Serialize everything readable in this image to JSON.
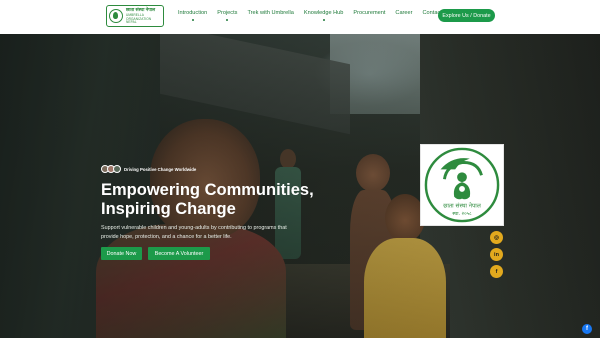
{
  "logo": {
    "name_nepali": "छाता संस्था नेपाल",
    "name_english": "UMBRELLA ORGANIZATION NEPAL"
  },
  "nav": {
    "items": [
      {
        "label": "Introduction",
        "has_dropdown": true
      },
      {
        "label": "Projects",
        "has_dropdown": true
      },
      {
        "label": "Trek with Umbrella",
        "has_dropdown": false
      },
      {
        "label": "Knowledge Hub",
        "has_dropdown": true
      },
      {
        "label": "Procurement",
        "has_dropdown": false
      },
      {
        "label": "Career",
        "has_dropdown": false
      },
      {
        "label": "Contact Us",
        "has_dropdown": false
      }
    ],
    "cta_label": "Explore Us / Donate"
  },
  "hero": {
    "eyebrow": "Driving Positive Change Worldwide",
    "headline_line1": "Empowering Communities,",
    "headline_line2": "Inspiring Change",
    "subtext": "Support vulnerable children and young-adults by contributing to programs that provide hope, protection, and a chance for a better life.",
    "donate_label": "Donate Now",
    "volunteer_label": "Become A Volunteer"
  },
  "seal": {
    "name_nepali": "छाता संस्था नेपाल",
    "year": "स्था. २०५८"
  },
  "social": {
    "icons": [
      "instagram-icon",
      "linkedin-icon",
      "facebook-icon"
    ],
    "chat_icon": "facebook-chat-icon"
  },
  "colors": {
    "brand_green": "#1c9a4a",
    "nav_text": "#1f7a3a",
    "social_gold": "#e2a91e",
    "facebook_blue": "#1877f2"
  }
}
